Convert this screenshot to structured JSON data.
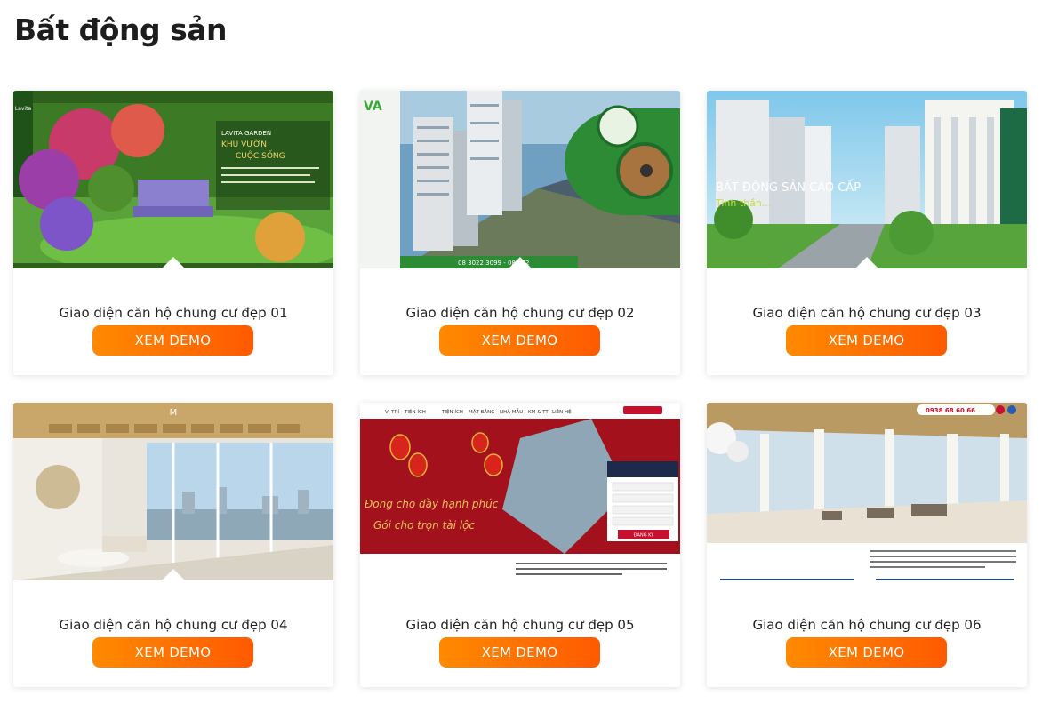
{
  "page": {
    "title": "Bất động sản"
  },
  "cards": [
    {
      "title": "Giao diện căn hộ chung cư đẹp 01",
      "button": "XEM DEMO",
      "thumb": {
        "brand": "Lavita",
        "heading": "LAVITA GARDEN",
        "tagline1": "KHU VƯỜN",
        "tagline2": "CUỘC SỐNG"
      }
    },
    {
      "title": "Giao diện căn hộ chung cư đẹp 02",
      "button": "XEM DEMO",
      "thumb": {
        "brand": "VA",
        "hotline": "08 3022 3099 - 08 302"
      }
    },
    {
      "title": "Giao diện căn hộ chung cư đẹp 03",
      "button": "XEM DEMO",
      "thumb": {
        "headline": "BẤT ĐỘNG SẢN CAO CẤP",
        "subline": "Tinh thần..."
      }
    },
    {
      "title": "Giao diện căn hộ chung cư đẹp 04",
      "button": "XEM DEMO",
      "thumb": {
        "brand": "M"
      }
    },
    {
      "title": "Giao diện căn hộ chung cư đẹp 05",
      "button": "XEM DEMO",
      "thumb": {
        "nav": [
          "VỊ TRÍ",
          "TIỆN ÍCH",
          "TIỆN ÍCH",
          "MẶT BẰNG",
          "NHÀ MẪU",
          "KM & TT",
          "LIÊN HỆ"
        ],
        "script1": "Đong cho đầy hạnh phúc",
        "script2": "Gói cho trọn tài lộc",
        "form_button": "ĐĂNG KÝ"
      }
    },
    {
      "title": "Giao diện căn hộ chung cư đẹp 06",
      "button": "XEM DEMO",
      "thumb": {
        "hotline": "0938 68 60 66"
      }
    }
  ],
  "colors": {
    "button_from": "#ff8a00",
    "button_to": "#ff5a00"
  }
}
